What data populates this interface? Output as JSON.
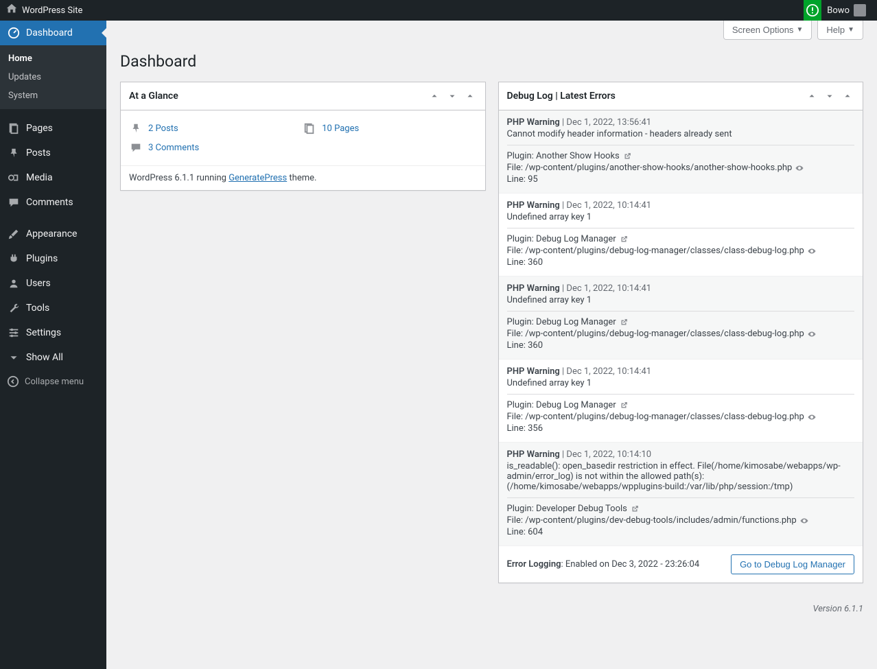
{
  "toolbar": {
    "site_name": "WordPress Site",
    "user_name": "Bowo"
  },
  "screen_meta": {
    "screen_options": "Screen Options",
    "help": "Help"
  },
  "page_title": "Dashboard",
  "sidebar": {
    "dashboard": "Dashboard",
    "sub_home": "Home",
    "sub_updates": "Updates",
    "sub_system": "System",
    "pages": "Pages",
    "posts": "Posts",
    "media": "Media",
    "comments": "Comments",
    "appearance": "Appearance",
    "plugins": "Plugins",
    "users": "Users",
    "tools": "Tools",
    "settings": "Settings",
    "show_all": "Show All",
    "collapse": "Collapse menu"
  },
  "glance": {
    "title": "At a Glance",
    "posts": "2 Posts",
    "pages": "10 Pages",
    "comments": "3 Comments",
    "running_pre": "WordPress 6.1.1 running ",
    "theme": "GeneratePress",
    "running_post": " theme."
  },
  "debug": {
    "title": "Debug Log | Latest Errors",
    "entries": [
      {
        "type": "PHP Warning",
        "time": "Dec 1, 2022, 13:56:41",
        "msg": "Cannot modify header information - headers already sent",
        "plugin": "Another Show Hooks",
        "file": "/wp-content/plugins/another-show-hooks/another-show-hooks.php",
        "line": "95"
      },
      {
        "type": "PHP Warning",
        "time": "Dec 1, 2022, 10:14:41",
        "msg": "Undefined array key 1",
        "plugin": "Debug Log Manager",
        "file": "/wp-content/plugins/debug-log-manager/classes/class-debug-log.php",
        "line": "360"
      },
      {
        "type": "PHP Warning",
        "time": "Dec 1, 2022, 10:14:41",
        "msg": "Undefined array key 1",
        "plugin": "Debug Log Manager",
        "file": "/wp-content/plugins/debug-log-manager/classes/class-debug-log.php",
        "line": "360"
      },
      {
        "type": "PHP Warning",
        "time": "Dec 1, 2022, 10:14:41",
        "msg": "Undefined array key 1",
        "plugin": "Debug Log Manager",
        "file": "/wp-content/plugins/debug-log-manager/classes/class-debug-log.php",
        "line": "356"
      },
      {
        "type": "PHP Warning",
        "time": "Dec 1, 2022, 10:14:10",
        "msg": "is_readable(): open_basedir restriction in effect. File(/home/kimosabe/webapps/wp-admin/error_log) is not within the allowed path(s): (/home/kimosabe/webapps/wpplugins-build:/var/lib/php/session:/tmp)",
        "plugin": "Developer Debug Tools",
        "file": "/wp-content/plugins/dev-debug-tools/includes/admin/functions.php",
        "line": "604"
      }
    ],
    "status_label": "Error Logging",
    "status_value": ": Enabled on Dec 3, 2022 - 23:26:04",
    "go_button": "Go to Debug Log Manager"
  },
  "labels": {
    "plugin": "Plugin: ",
    "file": "File: ",
    "line": "Line: "
  },
  "footer_version": "Version 6.1.1"
}
